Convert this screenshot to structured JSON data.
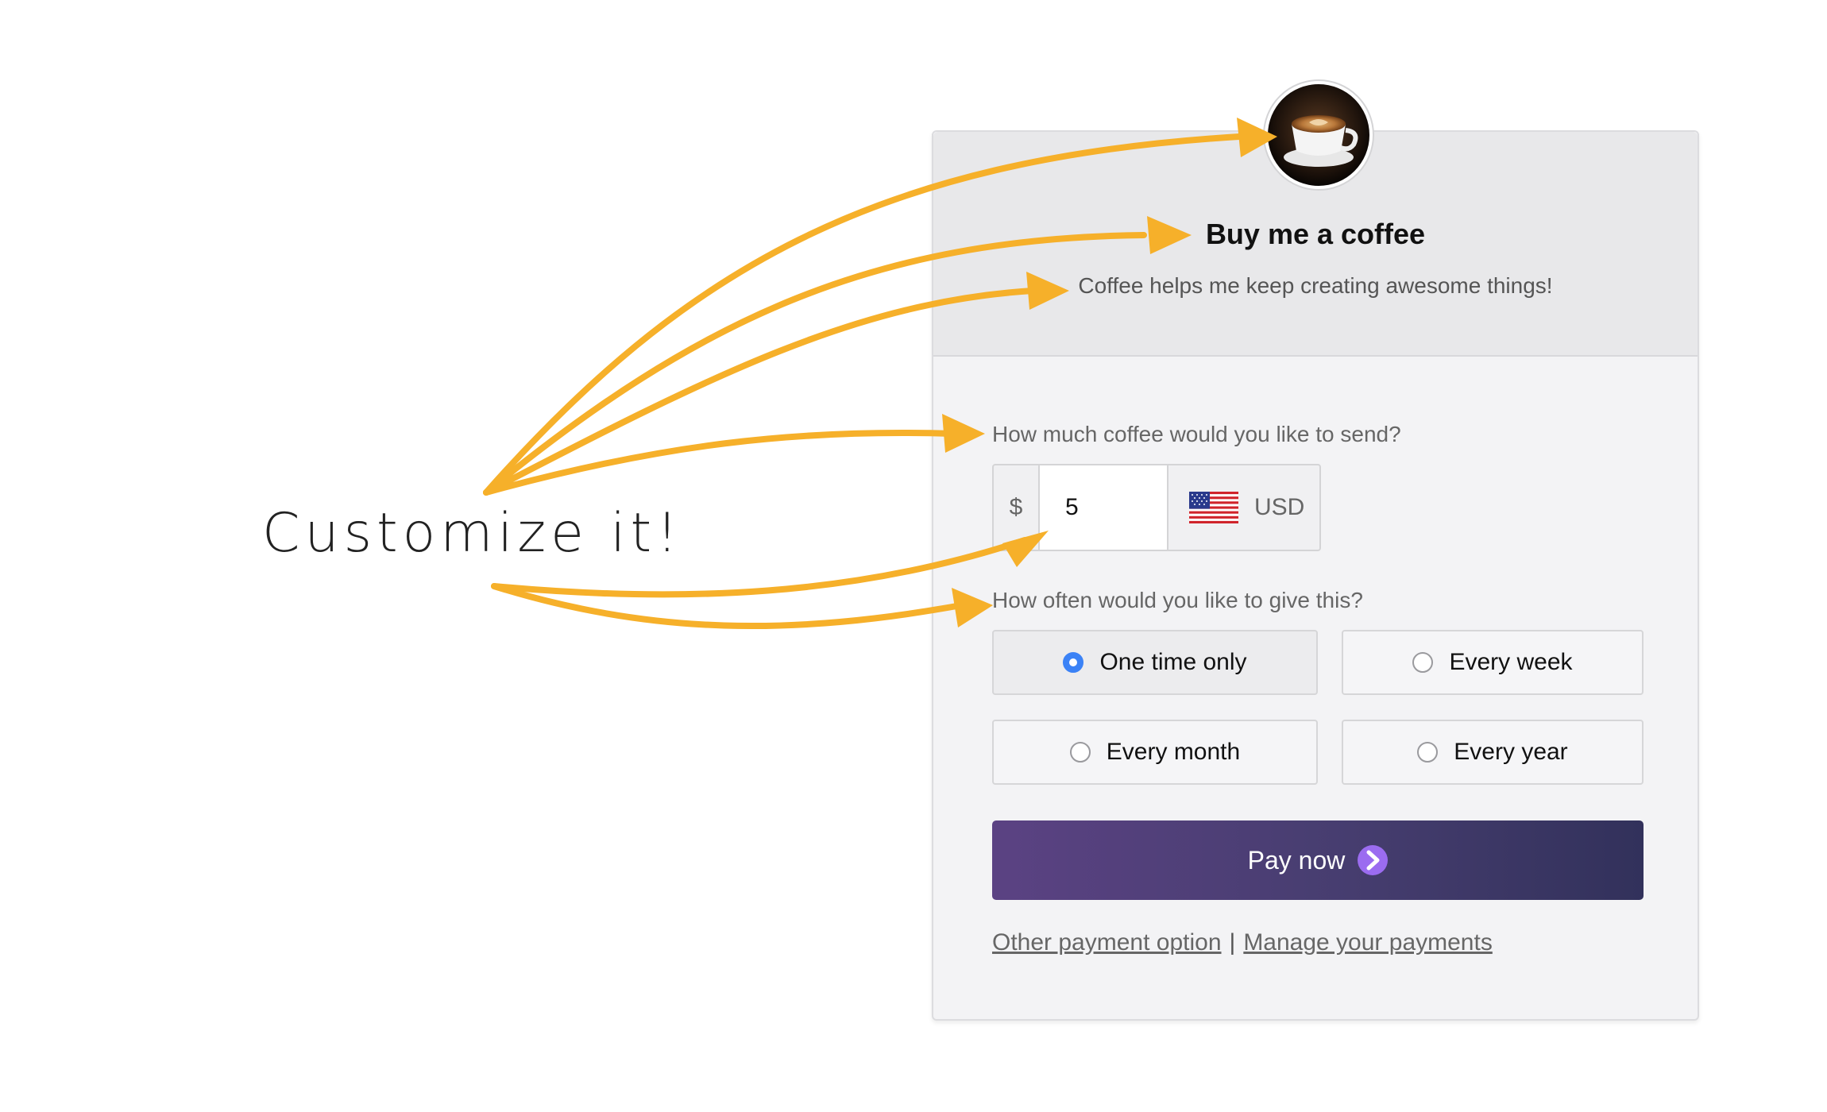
{
  "annotation": {
    "text": "Customize it!",
    "arrow_color": "#f6b02a"
  },
  "card": {
    "avatar_icon": "coffee-cup-icon",
    "title": "Buy me a coffee",
    "subtitle": "Coffee helps me keep creating awesome things!"
  },
  "amount": {
    "question": "How much coffee would you like to send?",
    "currency_symbol": "$",
    "value": "5",
    "flag_icon": "us-flag-icon",
    "currency": "USD"
  },
  "frequency": {
    "question": "How often would you like to give this?",
    "options": [
      {
        "label": "One time only",
        "selected": true
      },
      {
        "label": "Every week",
        "selected": false
      },
      {
        "label": "Every month",
        "selected": false
      },
      {
        "label": "Every year",
        "selected": false
      }
    ],
    "selected_color": "#3b82f6"
  },
  "pay_button": {
    "label": "Pay now",
    "icon": "chevron-right-icon"
  },
  "links": {
    "other": "Other payment option",
    "separator": "|",
    "manage": "Manage your payments"
  }
}
